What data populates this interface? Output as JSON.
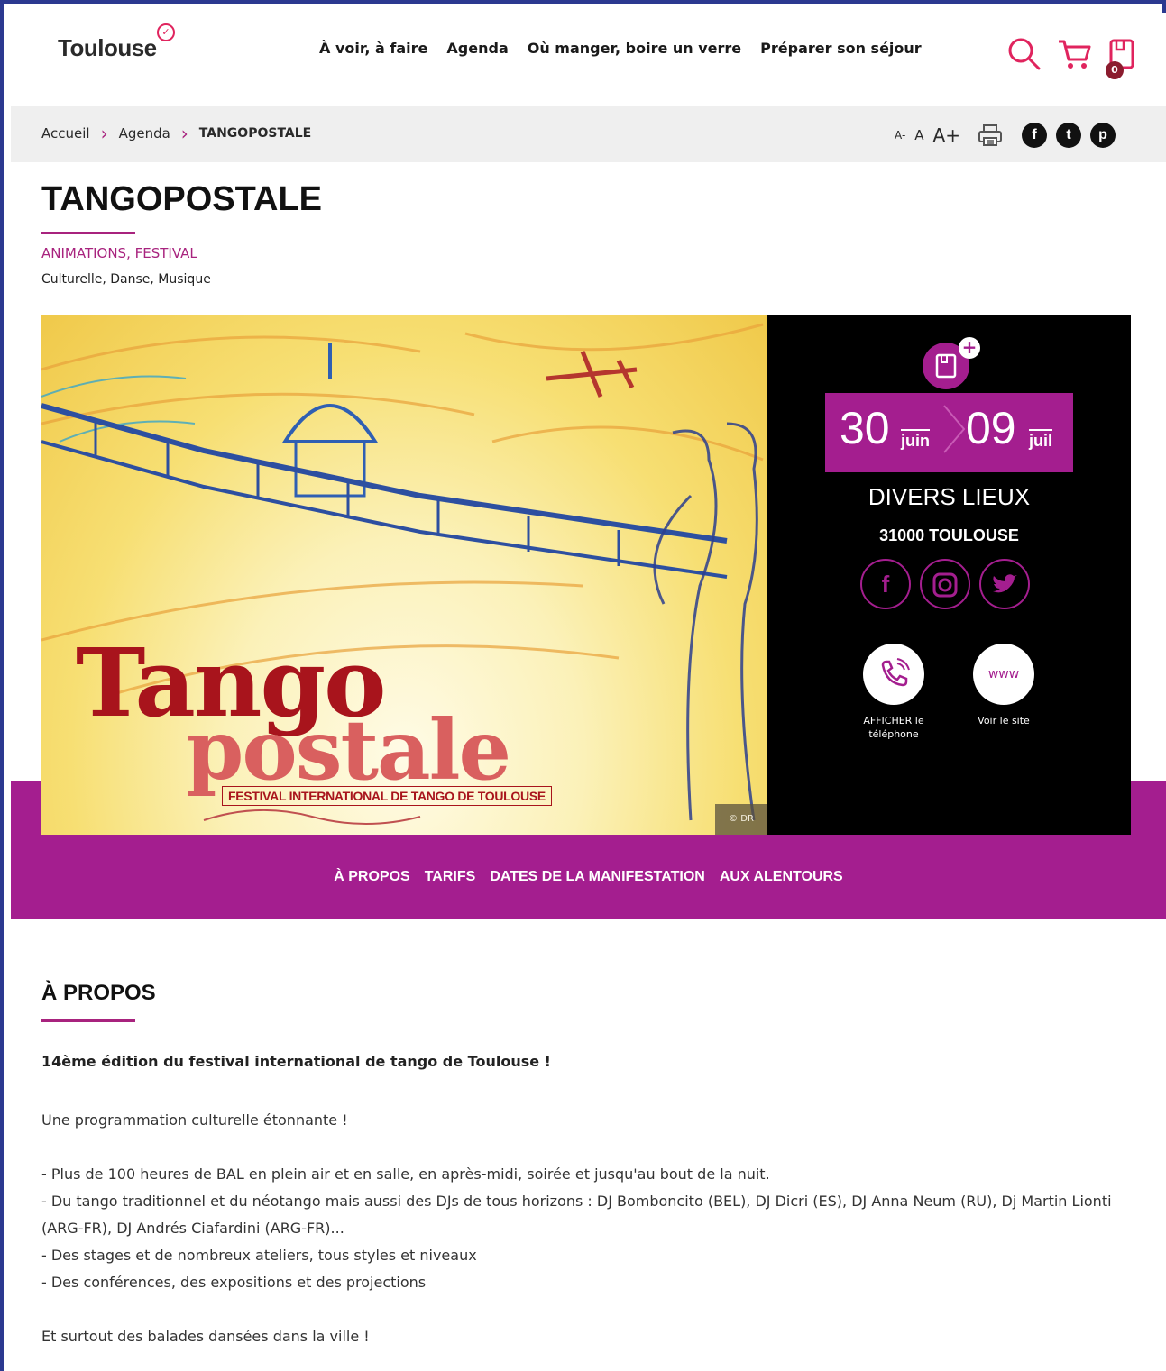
{
  "header": {
    "logo": "Toulouse",
    "nav": [
      "À voir, à faire",
      "Agenda",
      "Où manger, boire un verre",
      "Préparer son séjour"
    ],
    "cart_count": "0"
  },
  "breadcrumb": {
    "items": [
      "Accueil",
      "Agenda"
    ],
    "current": "TANGOPOSTALE"
  },
  "tools": {
    "font_small": "A-",
    "font_normal": "A",
    "font_large": "A+",
    "share": [
      "f",
      "t",
      "p"
    ]
  },
  "event": {
    "title": "TANGOPOSTALE",
    "categories": "ANIMATIONS, FESTIVAL",
    "subcategories": "Culturelle, Danse, Musique",
    "image_credit": "© DR",
    "poster_line1": "Tango",
    "poster_line2": "postale",
    "poster_subtitle": "FESTIVAL INTERNATIONAL DE TANGO DE TOULOUSE",
    "date_start_day": "30",
    "date_start_month": "juin",
    "date_end_day": "09",
    "date_end_month": "juil",
    "place": "DIVERS LIEUX",
    "city": "31000 TOULOUSE",
    "phone_label": "AFFICHER le téléphone",
    "site_label": "Voir le site",
    "site_icon_text": "www"
  },
  "tabs": [
    "À PROPOS",
    "TARIFS",
    "DATES DE LA MANIFESTATION",
    "AUX ALENTOURS"
  ],
  "about": {
    "heading": "À PROPOS",
    "lead": "14ème édition du festival international de tango de Toulouse !",
    "intro": "Une programmation culturelle étonnante !",
    "bullets": [
      "- Plus de 100 heures de BAL en plein air et en salle, en après-midi, soirée et jusqu'au bout de la nuit.",
      "- Du tango traditionnel et du néotango mais aussi des DJs de tous horizons : DJ Bomboncito (BEL), DJ Dicri (ES), DJ Anna Neum (RU), Dj Martin Lionti (ARG-FR), DJ Andrés Ciafardini (ARG-FR)...",
      "- Des stages et de nombreux ateliers, tous styles et niveaux",
      "- Des conférences, des expositions et des projections"
    ],
    "outro": "Et surtout des balades dansées dans la ville !"
  },
  "colors": {
    "accent": "#a41e8f",
    "frame": "#2b3990",
    "hero_panel": "#000000"
  }
}
